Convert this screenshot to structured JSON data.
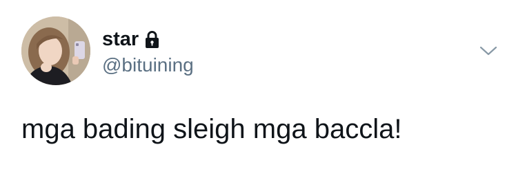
{
  "tweet": {
    "author": {
      "display_name": "star",
      "handle": "@bituining",
      "avatar_icon": "user-avatar-photo",
      "protected_icon": "lock-icon"
    },
    "text": "mga bading sleigh mga baccla!",
    "menu_icon": "chevron-down-icon"
  },
  "colors": {
    "text_primary": "#0f1419",
    "text_secondary": "#5b7083",
    "background": "#ffffff"
  }
}
